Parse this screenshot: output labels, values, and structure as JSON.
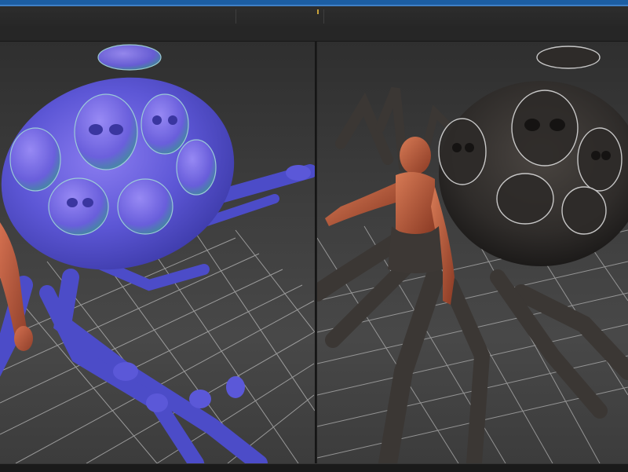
{
  "window": {
    "accent_color": "#1c5ea3"
  },
  "viewports": [
    {
      "id": "left",
      "shading": "normal-map",
      "model": "spider-creature-with-torso"
    },
    {
      "id": "right",
      "shading": "textured",
      "model": "spider-creature-with-torso"
    }
  ],
  "colors": {
    "normal_map_base": "#5b5bd6",
    "textured_body": "#3a3633",
    "skin": "#c0553a",
    "grid_line": "#bdbdbd"
  }
}
